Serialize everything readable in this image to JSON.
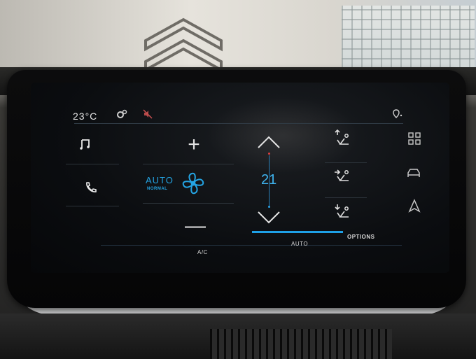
{
  "status": {
    "temperature": "23°C"
  },
  "climate": {
    "increase_symbol": "+",
    "decrease_symbol": "—",
    "mode_label": "AUTO",
    "mode_sub_label": "NORMAL",
    "set_temperature": "21"
  },
  "tabs": {
    "ac": "A/C",
    "auto": "AUTO",
    "options": "OPTIONS"
  },
  "colors": {
    "accent": "#1ea0e6",
    "text": "#e6e6e6",
    "screen_bg": "#0b0d10"
  },
  "icons": [
    "gear-icon",
    "mute-icon",
    "location-icon",
    "music-icon",
    "phone-icon",
    "fan-icon",
    "chevron-up-icon",
    "chevron-down-icon",
    "air-upper-icon",
    "air-middle-icon",
    "air-lower-icon",
    "apps-grid-icon",
    "car-icon",
    "navigation-icon"
  ]
}
